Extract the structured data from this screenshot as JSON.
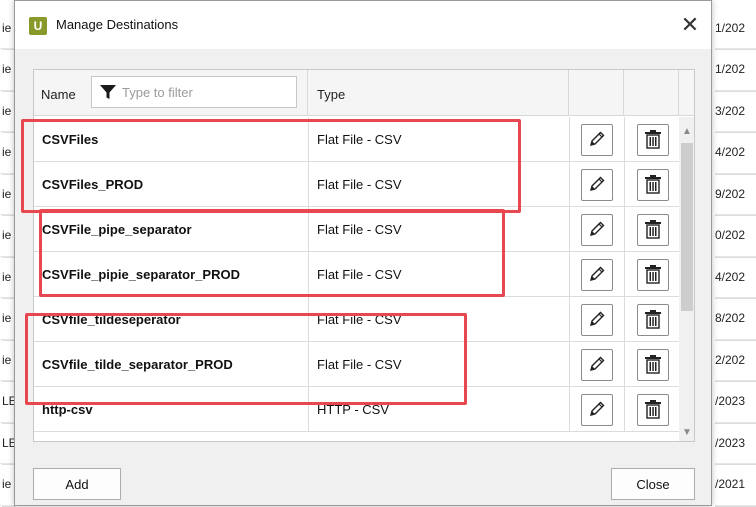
{
  "background": {
    "left_fragments": [
      "ie",
      "ie",
      "ie",
      "ie",
      "ie",
      "ie",
      "ie",
      "ie",
      "ie",
      "LE",
      "LE",
      "ie"
    ],
    "right_fragments": [
      "1/202",
      "1/202",
      "3/202",
      "4/202",
      "9/202",
      "0/202",
      "4/202",
      "8/202",
      "2/202",
      "/2023",
      "/2023",
      "/2021"
    ]
  },
  "dialog": {
    "icon_letter": "U",
    "title": "Manage Destinations",
    "close_glyph": "✕"
  },
  "grid": {
    "columns": {
      "name": "Name",
      "type": "Type"
    },
    "filter_placeholder": "Type to filter",
    "rows": [
      {
        "name": "CSVFiles",
        "type": "Flat File - CSV"
      },
      {
        "name": "CSVFiles_PROD",
        "type": "Flat File - CSV"
      },
      {
        "name": "CSVFile_pipe_separator",
        "type": "Flat File - CSV"
      },
      {
        "name": "CSVFile_pipie_separator_PROD",
        "type": "Flat File - CSV"
      },
      {
        "name": "CSVfile_tildeseperator",
        "type": "Flat File - CSV"
      },
      {
        "name": "CSVfile_tilde_separator_PROD",
        "type": "Flat File - CSV"
      },
      {
        "name": "http-csv",
        "type": "HTTP - CSV"
      }
    ],
    "row_icons": {
      "edit": "pencil-icon",
      "delete": "trash-icon"
    }
  },
  "highlight_color": "#e8474f",
  "buttons": {
    "add": "Add",
    "close": "Close"
  }
}
